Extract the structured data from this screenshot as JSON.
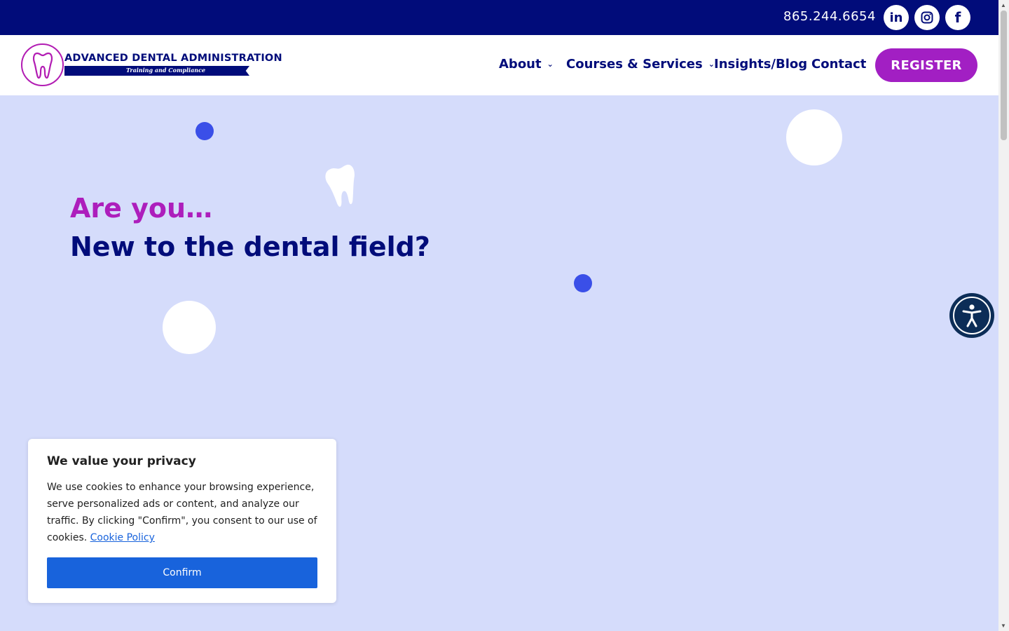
{
  "topbar": {
    "phone": "865.244.6654",
    "social": [
      {
        "name": "linkedin",
        "glyph": "in"
      },
      {
        "name": "instagram",
        "glyph": ""
      },
      {
        "name": "facebook",
        "glyph": "f"
      }
    ]
  },
  "logo": {
    "title": "ADVANCED DENTAL ADMINISTRATION",
    "subtitle": "Training and Compliance"
  },
  "nav": {
    "about": "About",
    "courses": "Courses & Services",
    "blog": "Insights/Blog",
    "contact": "Contact",
    "register": "REGISTER"
  },
  "hero": {
    "line1": "Are you…",
    "line2": "New to the dental field?"
  },
  "cookie": {
    "title": "We value your privacy",
    "text": "We use cookies to enhance your browsing experience, serve personalized ads or content, and analyze our traffic. By clicking \"Confirm\", you consent to our use of cookies.",
    "link": "Cookie Policy",
    "confirm": "Confirm"
  },
  "colors": {
    "navy": "#010c7a",
    "magenta": "#ad1ebc",
    "hero_bg": "#d5dcfb",
    "blue_dot": "#3a4fe8",
    "confirm_blue": "#1863dc"
  }
}
